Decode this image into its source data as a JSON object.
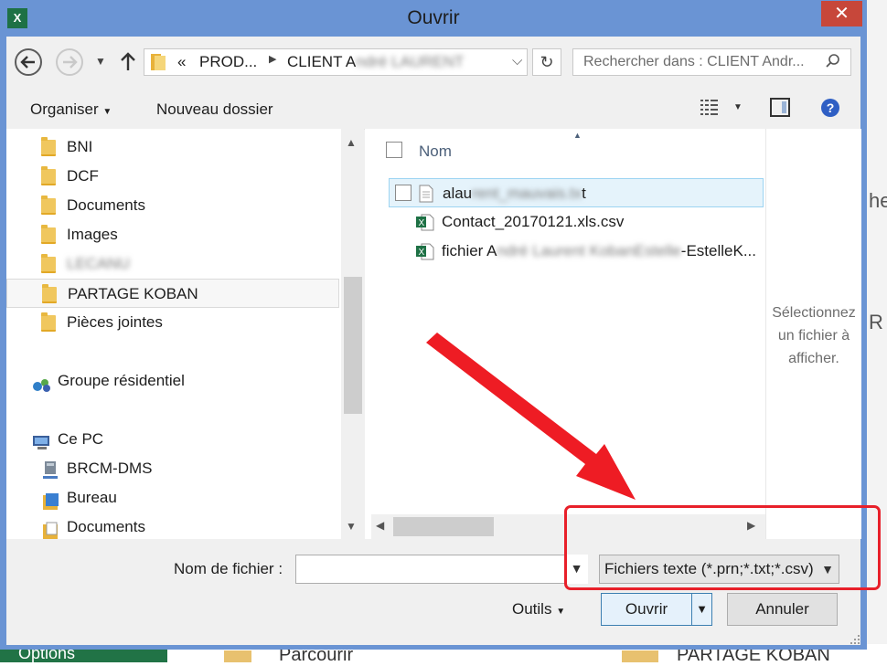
{
  "window": {
    "title": "Ouvrir",
    "close_label": "✕",
    "app_icon": "excel-icon"
  },
  "address": {
    "overflow": "«",
    "crumb1": "PROD...",
    "crumb2": "CLIENT André LAURENT",
    "crumb2_visible": "CLIENT A",
    "crumb2_blurred": "ndré LAURENT"
  },
  "search": {
    "placeholder": "Rechercher dans : CLIENT Andr..."
  },
  "toolbar": {
    "organize": "Organiser",
    "new_folder": "Nouveau dossier"
  },
  "nav": {
    "items": [
      {
        "label": "BNI"
      },
      {
        "label": "DCF"
      },
      {
        "label": "Documents"
      },
      {
        "label": "Images"
      },
      {
        "label": "LECANU"
      },
      {
        "label": "PARTAGE KOBAN"
      },
      {
        "label": "Pièces jointes"
      }
    ],
    "homegroup": "Groupe résidentiel",
    "thispc": "Ce PC",
    "pc_items": [
      {
        "label": "BRCM-DMS"
      },
      {
        "label": "Bureau"
      },
      {
        "label": "Documents"
      }
    ]
  },
  "files": {
    "column_name": "Nom",
    "items": [
      {
        "pre": "alau",
        "blur": "rent_mauvais.tx",
        "post": "t"
      },
      {
        "pre": "Contact_20170121.xls.csv",
        "blur": "",
        "post": ""
      },
      {
        "pre": "fichier A",
        "blur": "ndré Laurent KobanEstelle",
        "post": "-EstelleK..."
      }
    ]
  },
  "preview": {
    "line1": "Sélectionnez",
    "line2": "un fichier à",
    "line3": "afficher."
  },
  "bottom": {
    "filename_label": "Nom de fichier :",
    "filename_value": "",
    "filetype": "Fichiers texte (*.prn;*.txt;*.csv)",
    "tools": "Outils",
    "open": "Ouvrir",
    "cancel": "Annuler"
  },
  "background": {
    "right_text1": "he",
    "right_text2": "R",
    "bottom_left": "Options",
    "bottom_mid": "Parcourir",
    "bottom_right": "PARTAGE KOBAN"
  },
  "colors": {
    "dialog_frame": "#6a94d4",
    "close_red": "#c7473a",
    "annotation_red": "#e8202a",
    "excel_green": "#1e7145"
  }
}
